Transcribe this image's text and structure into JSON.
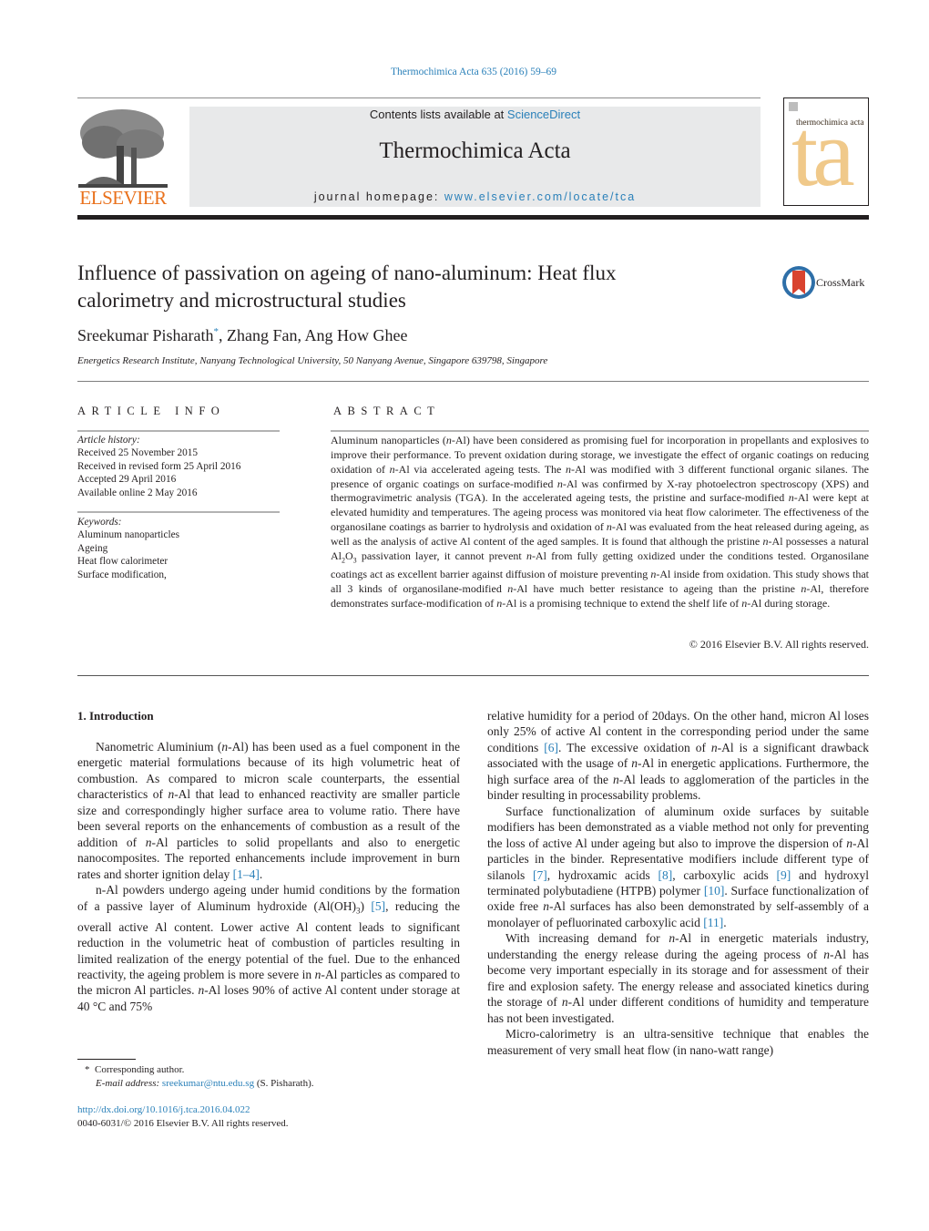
{
  "header": {
    "journal_ref": "Thermochimica Acta 635 (2016) 59–69",
    "contents_prefix": "Contents lists available at ",
    "contents_link": "ScienceDirect",
    "journal_title": "Thermochimica Acta",
    "homepage_prefix": "journal homepage: ",
    "homepage_link": "www.elsevier.com/locate/tca",
    "publisher_logo_text": "ELSEVIER",
    "cover_title": "thermochimica acta",
    "cover_letters": "ta",
    "colors": {
      "link": "#2a80b9",
      "elsevier_orange": "#e9711c",
      "cover_accent": "#f0c98a",
      "header_bg": "#e8e9ea"
    }
  },
  "article": {
    "title_line1": "Influence of passivation on ageing of nano-aluminum: Heat flux",
    "title_line2": "calorimetry and microstructural studies",
    "crossmark_label": "CrossMark",
    "authors": [
      {
        "name": "Sreekumar Pisharath",
        "mark": "*"
      },
      {
        "name": "Zhang Fan"
      },
      {
        "name": "Ang How Ghee"
      }
    ],
    "author_sep": ", ",
    "affiliation": "Energetics Research Institute, Nanyang Technological University, 50 Nanyang Avenue, Singapore 639798, Singapore"
  },
  "article_info": {
    "heading": "ARTICLE INFO",
    "history_label": "Article history:",
    "history": [
      "Received 25 November 2015",
      "Received in revised form 25 April 2016",
      "Accepted 29 April 2016",
      "Available online 2 May 2016"
    ],
    "keywords_label": "Keywords:",
    "keywords": [
      "Aluminum nanoparticles",
      "Ageing",
      "Heat flow calorimeter",
      "Surface modification,"
    ]
  },
  "abstract": {
    "heading": "ABSTRACT",
    "text": [
      "Aluminum nanoparticles (",
      "n",
      "-Al) have been considered as promising fuel for incorporation in propellants and explosives to improve their performance. To prevent oxidation during storage, we investigate the effect of organic coatings on reducing oxidation of ",
      "n",
      "-Al via accelerated ageing tests. The ",
      "n",
      "-Al was modified with 3 different functional organic silanes. The presence of organic coatings on surface-modified ",
      "n",
      "-Al was confirmed by X-ray photoelectron spectroscopy (XPS) and thermogravimetric analysis (TGA). In the accelerated ageing tests, the pristine and surface-modified ",
      "n",
      "-Al were kept at elevated humidity and temperatures. The ageing process was monitored via heat flow calorimeter. The effectiveness of the organosilane coatings as barrier to hydrolysis and oxidation of ",
      "n",
      "-Al was evaluated from the heat released during ageing, as well as the analysis of active Al content of the aged samples. It is found that although the pristine ",
      "n",
      "-Al possesses a natural Al",
      "2",
      "O",
      "3",
      " passivation layer, it cannot prevent ",
      "n",
      "-Al from fully getting oxidized under the conditions tested. Organosilane coatings act as excellent barrier against diffusion of moisture preventing ",
      "n",
      "-Al inside from oxidation. This study shows that all 3 kinds of organosilane-modified ",
      "n",
      "-Al have much better resistance to ageing than the pristine ",
      "n",
      "-Al, therefore demonstrates surface-modification of ",
      "n",
      "-Al is a promising technique to extend the shelf life of ",
      "n",
      "-Al during storage."
    ],
    "copyright": "© 2016 Elsevier B.V. All rights reserved."
  },
  "body": {
    "section_heading": "1.  Introduction",
    "left": {
      "p1": [
        "Nanometric Aluminium (",
        "n",
        "-Al) has been used as a fuel component in the energetic material formulations because of its high volumetric heat of combustion. As compared to micron scale counterparts, the essential characteristics of ",
        "n",
        "-Al that lead to enhanced reactivity are smaller particle size and correspondingly higher surface area to volume ratio. There have been several reports on the enhancements of combustion as a result of the addition of ",
        "n",
        "-Al particles to solid propellants and also to energetic nanocomposites. The reported enhancements include improvement in burn rates and shorter ignition delay ",
        "[1–4]",
        "."
      ],
      "p2": [
        "n-Al powders undergo ageing under humid conditions by the formation of a passive layer of Aluminum hydroxide (Al(OH)",
        "3",
        ") ",
        "[5]",
        ", reducing the overall active Al content. Lower active Al content leads to significant reduction in the volumetric heat of combustion of particles resulting in limited realization of the energy potential of the fuel. Due to the enhanced reactivity, the ageing problem is more severe in ",
        "n",
        "-Al particles as compared to the micron Al particles. ",
        "n",
        "-Al loses 90% of active Al content under storage at 40 °C and 75%"
      ]
    },
    "right": {
      "p1": [
        "relative humidity for a period of 20days. On the other hand, micron Al loses only 25% of active Al content in the corresponding period under the same conditions ",
        "[6]",
        ". The excessive oxidation of ",
        "n",
        "-Al is a significant drawback associated with the usage of ",
        "n",
        "-Al in energetic applications. Furthermore, the high surface area of the ",
        "n",
        "-Al leads to agglomeration of the particles in the binder resulting in processability problems."
      ],
      "p2": [
        "Surface functionalization of aluminum oxide surfaces by suitable modifiers has been demonstrated as a viable method not only for preventing the loss of active Al under ageing but also to improve the dispersion of ",
        "n",
        "-Al particles in the binder. Representative modifiers include different type of silanols ",
        "[7]",
        ", hydroxamic acids ",
        "[8]",
        ", carboxylic acids ",
        "[9]",
        " and hydroxyl terminated polybutadiene (HTPB) polymer ",
        "[10]",
        ". Surface functionalization of oxide free ",
        "n",
        "-Al surfaces has also been demonstrated by self-assembly of a monolayer of pefluorinated carboxylic acid ",
        "[11]",
        "."
      ],
      "p3": [
        "With increasing demand for ",
        "n",
        "-Al in energetic materials industry, understanding the energy release during the ageing process of ",
        "n",
        "-Al has become very important especially in its storage and for assessment of their fire and explosion safety. The energy release and associated kinetics during the storage of ",
        "n",
        "-Al under different conditions of humidity and temperature has not been investigated."
      ],
      "p4": [
        "Micro-calorimetry is an ultra-sensitive technique that enables the measurement of very small heat flow (in nano-watt range)"
      ]
    }
  },
  "footnote": {
    "mark": "*",
    "corresponding": "Corresponding author.",
    "email_label": "E-mail address: ",
    "email": "sreekumar@ntu.edu.sg",
    "email_suffix": " (S. Pisharath).",
    "doi": "http://dx.doi.org/10.1016/j.tca.2016.04.022",
    "issn_line": "0040-6031/© 2016 Elsevier B.V. All rights reserved."
  }
}
